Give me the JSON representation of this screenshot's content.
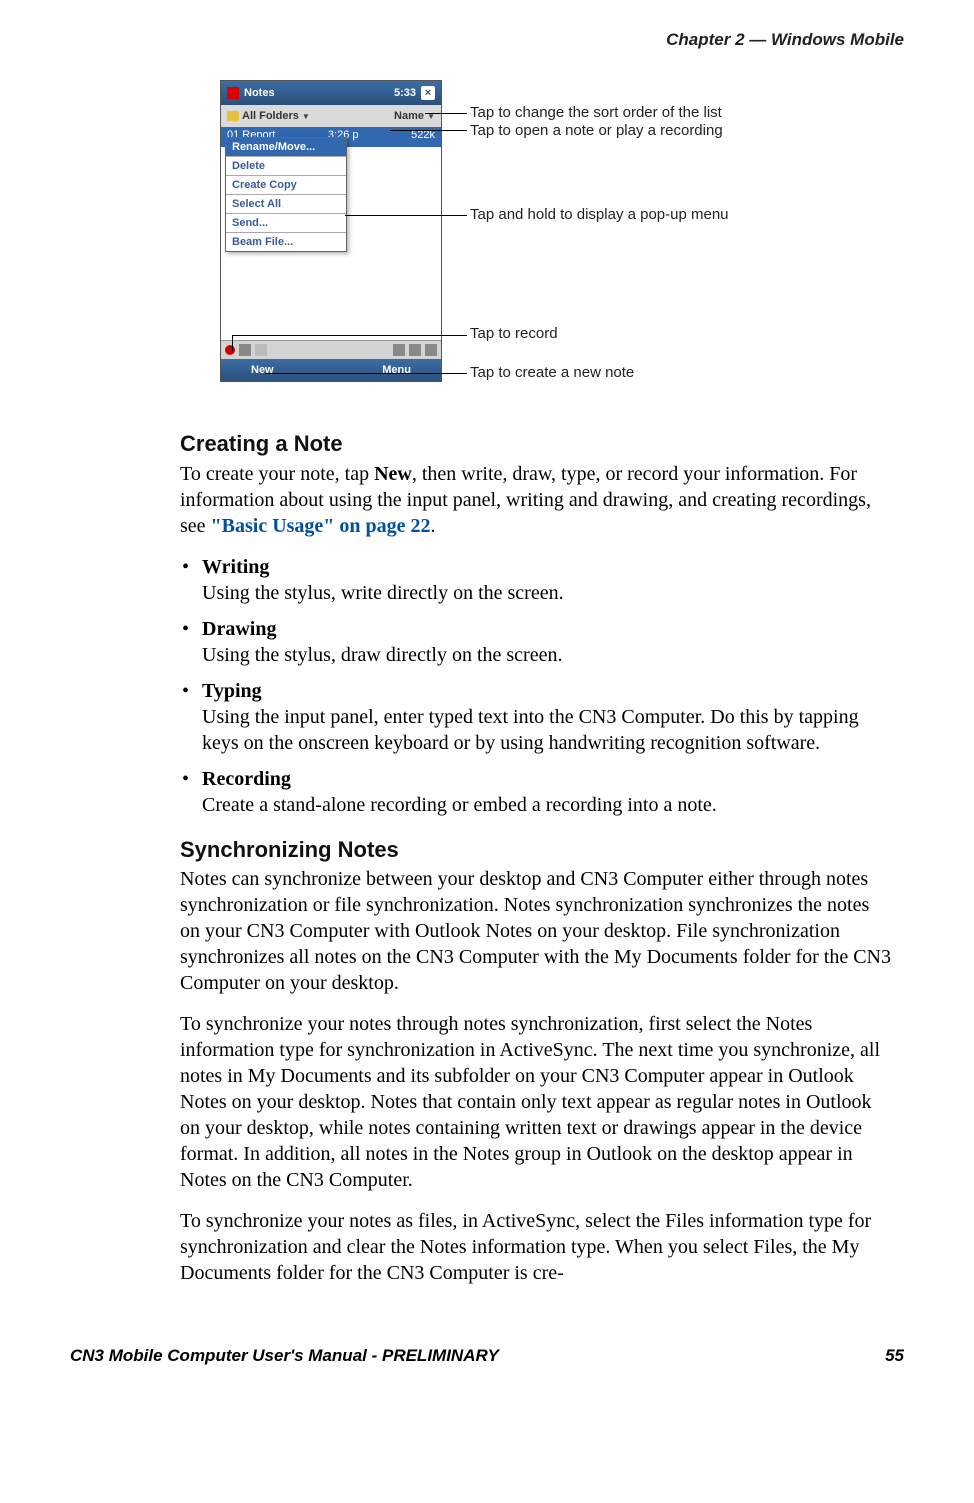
{
  "header": {
    "chapter_line": "Chapter 2 —  Windows Mobile"
  },
  "screenshot": {
    "titlebar_label": "Notes",
    "titlebar_time": "5:33",
    "folder_label": "All Folders",
    "sort_label": "Name",
    "row_name": "01 Report",
    "row_time": "3:26 p",
    "row_size": "522k",
    "menu": {
      "item1": "Rename/Move...",
      "item2": "Delete",
      "item3": "Create Copy",
      "item4": "Select All",
      "item5": "Send...",
      "item6": "Beam File..."
    },
    "bottom_new": "New",
    "bottom_menu": "Menu"
  },
  "callouts": {
    "sort": "Tap to change the sort order of the list",
    "open": "Tap to open a note or play a recording",
    "hold": "Tap and hold to display a pop-up menu",
    "record": "Tap to record",
    "new": "Tap to create a new note"
  },
  "section1": {
    "heading": "Creating a Note",
    "para_lead": "To create your note, tap ",
    "para_new_bold": "New",
    "para_rest": ", then write, draw, type, or record your information. For information about using the input panel, writing and drawing, and creating recordings, see ",
    "link_text": "\"Basic Usage\" on page 22",
    "period": ".",
    "items": {
      "writing_t": "Writing",
      "writing_d": "Using the stylus, write directly on the screen.",
      "drawing_t": "Drawing",
      "drawing_d": "Using the stylus, draw directly on the screen.",
      "typing_t": "Typing",
      "typing_d": "Using the input panel, enter typed text into the CN3 Computer. Do this by tapping keys on the onscreen keyboard or by using handwriting recognition software.",
      "recording_t": "Recording",
      "recording_d": "Create a stand-alone recording or embed a recording into a note."
    }
  },
  "section2": {
    "heading": "Synchronizing Notes",
    "p1": "Notes can synchronize between your desktop and CN3 Computer either through notes synchronization or file synchronization. Notes synchronization synchronizes the notes on your CN3 Computer with Outlook Notes on your desktop. File synchronization synchronizes all notes on the CN3 Computer with the My Documents folder for the CN3 Computer on your desktop.",
    "p2": "To synchronize your notes through notes synchronization, first select the Notes information type for synchronization in ActiveSync. The next time you synchronize, all notes in My Documents and its subfolder on your CN3 Computer appear in Outlook Notes on your desktop. Notes that contain only text appear as regular notes in Outlook on your desktop, while notes containing written text or drawings appear in the device format. In addition, all notes in the Notes group in Outlook on the desktop appear in Notes on the CN3 Computer.",
    "p3": "To synchronize your notes as files, in ActiveSync, select the Files information type for synchronization and clear the Notes information type. When you select Files, the My Documents folder for the CN3 Computer is cre-"
  },
  "footer": {
    "left": "CN3 Mobile Computer User's Manual - PRELIMINARY",
    "page_number": "55"
  }
}
